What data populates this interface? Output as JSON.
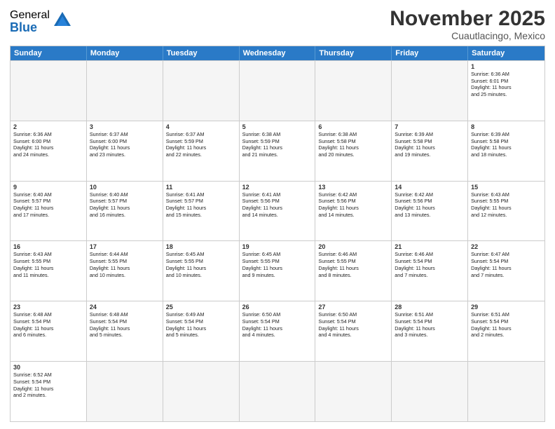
{
  "header": {
    "logo_general": "General",
    "logo_blue": "Blue",
    "main_title": "November 2025",
    "subtitle": "Cuautlacingo, Mexico"
  },
  "calendar": {
    "days": [
      "Sunday",
      "Monday",
      "Tuesday",
      "Wednesday",
      "Thursday",
      "Friday",
      "Saturday"
    ],
    "rows": [
      [
        {
          "day": "",
          "text": "",
          "empty": true
        },
        {
          "day": "",
          "text": "",
          "empty": true
        },
        {
          "day": "",
          "text": "",
          "empty": true
        },
        {
          "day": "",
          "text": "",
          "empty": true
        },
        {
          "day": "",
          "text": "",
          "empty": true
        },
        {
          "day": "",
          "text": "",
          "empty": true
        },
        {
          "day": "1",
          "text": "Sunrise: 6:36 AM\nSunset: 6:01 PM\nDaylight: 11 hours\nand 25 minutes.",
          "empty": false
        }
      ],
      [
        {
          "day": "2",
          "text": "Sunrise: 6:36 AM\nSunset: 6:00 PM\nDaylight: 11 hours\nand 24 minutes.",
          "empty": false
        },
        {
          "day": "3",
          "text": "Sunrise: 6:37 AM\nSunset: 6:00 PM\nDaylight: 11 hours\nand 23 minutes.",
          "empty": false
        },
        {
          "day": "4",
          "text": "Sunrise: 6:37 AM\nSunset: 5:59 PM\nDaylight: 11 hours\nand 22 minutes.",
          "empty": false
        },
        {
          "day": "5",
          "text": "Sunrise: 6:38 AM\nSunset: 5:59 PM\nDaylight: 11 hours\nand 21 minutes.",
          "empty": false
        },
        {
          "day": "6",
          "text": "Sunrise: 6:38 AM\nSunset: 5:58 PM\nDaylight: 11 hours\nand 20 minutes.",
          "empty": false
        },
        {
          "day": "7",
          "text": "Sunrise: 6:39 AM\nSunset: 5:58 PM\nDaylight: 11 hours\nand 19 minutes.",
          "empty": false
        },
        {
          "day": "8",
          "text": "Sunrise: 6:39 AM\nSunset: 5:58 PM\nDaylight: 11 hours\nand 18 minutes.",
          "empty": false
        }
      ],
      [
        {
          "day": "9",
          "text": "Sunrise: 6:40 AM\nSunset: 5:57 PM\nDaylight: 11 hours\nand 17 minutes.",
          "empty": false
        },
        {
          "day": "10",
          "text": "Sunrise: 6:40 AM\nSunset: 5:57 PM\nDaylight: 11 hours\nand 16 minutes.",
          "empty": false
        },
        {
          "day": "11",
          "text": "Sunrise: 6:41 AM\nSunset: 5:57 PM\nDaylight: 11 hours\nand 15 minutes.",
          "empty": false
        },
        {
          "day": "12",
          "text": "Sunrise: 6:41 AM\nSunset: 5:56 PM\nDaylight: 11 hours\nand 14 minutes.",
          "empty": false
        },
        {
          "day": "13",
          "text": "Sunrise: 6:42 AM\nSunset: 5:56 PM\nDaylight: 11 hours\nand 14 minutes.",
          "empty": false
        },
        {
          "day": "14",
          "text": "Sunrise: 6:42 AM\nSunset: 5:56 PM\nDaylight: 11 hours\nand 13 minutes.",
          "empty": false
        },
        {
          "day": "15",
          "text": "Sunrise: 6:43 AM\nSunset: 5:55 PM\nDaylight: 11 hours\nand 12 minutes.",
          "empty": false
        }
      ],
      [
        {
          "day": "16",
          "text": "Sunrise: 6:43 AM\nSunset: 5:55 PM\nDaylight: 11 hours\nand 11 minutes.",
          "empty": false
        },
        {
          "day": "17",
          "text": "Sunrise: 6:44 AM\nSunset: 5:55 PM\nDaylight: 11 hours\nand 10 minutes.",
          "empty": false
        },
        {
          "day": "18",
          "text": "Sunrise: 6:45 AM\nSunset: 5:55 PM\nDaylight: 11 hours\nand 10 minutes.",
          "empty": false
        },
        {
          "day": "19",
          "text": "Sunrise: 6:45 AM\nSunset: 5:55 PM\nDaylight: 11 hours\nand 9 minutes.",
          "empty": false
        },
        {
          "day": "20",
          "text": "Sunrise: 6:46 AM\nSunset: 5:55 PM\nDaylight: 11 hours\nand 8 minutes.",
          "empty": false
        },
        {
          "day": "21",
          "text": "Sunrise: 6:46 AM\nSunset: 5:54 PM\nDaylight: 11 hours\nand 7 minutes.",
          "empty": false
        },
        {
          "day": "22",
          "text": "Sunrise: 6:47 AM\nSunset: 5:54 PM\nDaylight: 11 hours\nand 7 minutes.",
          "empty": false
        }
      ],
      [
        {
          "day": "23",
          "text": "Sunrise: 6:48 AM\nSunset: 5:54 PM\nDaylight: 11 hours\nand 6 minutes.",
          "empty": false
        },
        {
          "day": "24",
          "text": "Sunrise: 6:48 AM\nSunset: 5:54 PM\nDaylight: 11 hours\nand 5 minutes.",
          "empty": false
        },
        {
          "day": "25",
          "text": "Sunrise: 6:49 AM\nSunset: 5:54 PM\nDaylight: 11 hours\nand 5 minutes.",
          "empty": false
        },
        {
          "day": "26",
          "text": "Sunrise: 6:50 AM\nSunset: 5:54 PM\nDaylight: 11 hours\nand 4 minutes.",
          "empty": false
        },
        {
          "day": "27",
          "text": "Sunrise: 6:50 AM\nSunset: 5:54 PM\nDaylight: 11 hours\nand 4 minutes.",
          "empty": false
        },
        {
          "day": "28",
          "text": "Sunrise: 6:51 AM\nSunset: 5:54 PM\nDaylight: 11 hours\nand 3 minutes.",
          "empty": false
        },
        {
          "day": "29",
          "text": "Sunrise: 6:51 AM\nSunset: 5:54 PM\nDaylight: 11 hours\nand 2 minutes.",
          "empty": false
        }
      ],
      [
        {
          "day": "30",
          "text": "Sunrise: 6:52 AM\nSunset: 5:54 PM\nDaylight: 11 hours\nand 2 minutes.",
          "empty": false
        },
        {
          "day": "",
          "text": "",
          "empty": true
        },
        {
          "day": "",
          "text": "",
          "empty": true
        },
        {
          "day": "",
          "text": "",
          "empty": true
        },
        {
          "day": "",
          "text": "",
          "empty": true
        },
        {
          "day": "",
          "text": "",
          "empty": true
        },
        {
          "day": "",
          "text": "",
          "empty": true
        }
      ]
    ]
  }
}
